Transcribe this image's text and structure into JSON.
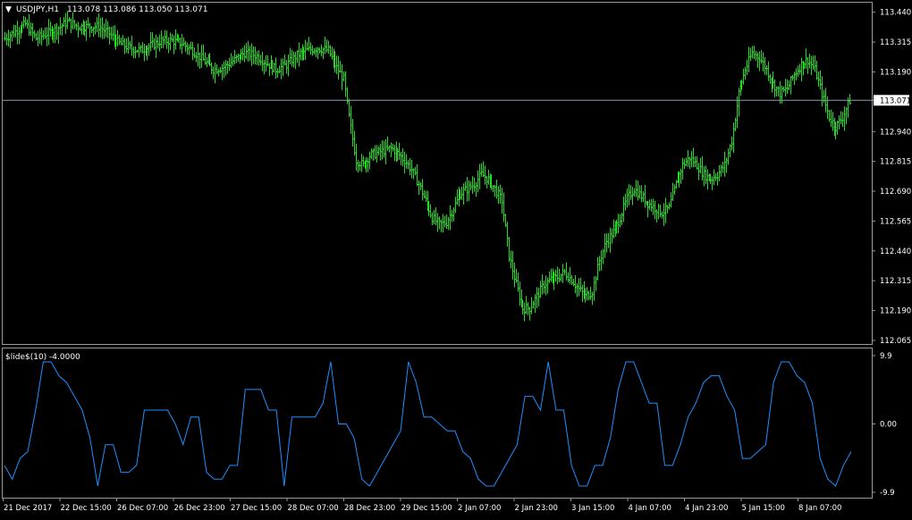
{
  "window": {
    "symbol_label": "USDJPY,H1",
    "ohlc_text": "113.078 113.086 113.050 113.071",
    "dropdown_glyph": "▼"
  },
  "indicator": {
    "label": "$lide$(10) -4.0000"
  },
  "colors": {
    "background": "#000000",
    "candle": "#22dd22",
    "indicator_line": "#1e90ff",
    "frame": "#9a9a9a",
    "grid_text": "#ffffff",
    "price_line": "#8a9fb0",
    "price_tag_bg": "#ffffff",
    "price_tag_text": "#000000"
  },
  "chart_data": [
    {
      "type": "ohlc",
      "symbol": "USDJPY",
      "timeframe": "H1",
      "current_price": 113.071,
      "y_ticks": [
        "113.440",
        "113.315",
        "113.190",
        "113.071",
        "112.940",
        "112.815",
        "112.690",
        "112.565",
        "112.440",
        "112.315",
        "112.190",
        "112.065"
      ],
      "y_tick_values": [
        113.44,
        113.315,
        113.19,
        113.071,
        112.94,
        112.815,
        112.69,
        112.565,
        112.44,
        112.315,
        112.19,
        112.065
      ],
      "ylim": [
        112.05,
        113.48
      ],
      "x_labels": [
        "21 Dec 2017",
        "22 Dec 15:00",
        "26 Dec 07:00",
        "26 Dec 23:00",
        "27 Dec 15:00",
        "28 Dec 07:00",
        "28 Dec 23:00",
        "29 Dec 15:00",
        "2 Jan 07:00",
        "2 Jan 23:00",
        "3 Jan 15:00",
        "4 Jan 07:00",
        "4 Jan 23:00",
        "5 Jan 15:00",
        "8 Jan 07:00"
      ],
      "close_path": [
        [
          0,
          113.33
        ],
        [
          6,
          113.36
        ],
        [
          12,
          113.39
        ],
        [
          18,
          113.33
        ],
        [
          24,
          113.35
        ],
        [
          30,
          113.37
        ],
        [
          36,
          113.4
        ],
        [
          42,
          113.38
        ],
        [
          48,
          113.38
        ],
        [
          54,
          113.38
        ],
        [
          60,
          113.35
        ],
        [
          66,
          113.31
        ],
        [
          72,
          113.29
        ],
        [
          78,
          113.28
        ],
        [
          84,
          113.3
        ],
        [
          90,
          113.32
        ],
        [
          96,
          113.32
        ],
        [
          102,
          113.31
        ],
        [
          108,
          113.28
        ],
        [
          114,
          113.24
        ],
        [
          120,
          113.2
        ],
        [
          126,
          113.21
        ],
        [
          132,
          113.24
        ],
        [
          138,
          113.27
        ],
        [
          144,
          113.26
        ],
        [
          150,
          113.23
        ],
        [
          156,
          113.2
        ],
        [
          162,
          113.22
        ],
        [
          168,
          113.26
        ],
        [
          174,
          113.28
        ],
        [
          180,
          113.29
        ],
        [
          186,
          113.28
        ],
        [
          190,
          113.22
        ],
        [
          195,
          113.16
        ],
        [
          198,
          113.0
        ],
        [
          202,
          112.82
        ],
        [
          206,
          112.8
        ],
        [
          210,
          112.84
        ],
        [
          214,
          112.85
        ],
        [
          218,
          112.86
        ],
        [
          222,
          112.87
        ],
        [
          226,
          112.85
        ],
        [
          230,
          112.82
        ],
        [
          234,
          112.78
        ],
        [
          238,
          112.72
        ],
        [
          242,
          112.65
        ],
        [
          246,
          112.58
        ],
        [
          250,
          112.55
        ],
        [
          254,
          112.56
        ],
        [
          258,
          112.62
        ],
        [
          262,
          112.68
        ],
        [
          266,
          112.7
        ],
        [
          270,
          112.72
        ],
        [
          274,
          112.76
        ],
        [
          278,
          112.74
        ],
        [
          282,
          112.7
        ],
        [
          286,
          112.65
        ],
        [
          290,
          112.42
        ],
        [
          294,
          112.3
        ],
        [
          298,
          112.2
        ],
        [
          302,
          112.2
        ],
        [
          306,
          112.25
        ],
        [
          310,
          112.3
        ],
        [
          314,
          112.32
        ],
        [
          318,
          112.33
        ],
        [
          322,
          112.35
        ],
        [
          326,
          112.32
        ],
        [
          330,
          112.28
        ],
        [
          334,
          112.25
        ],
        [
          338,
          112.27
        ],
        [
          342,
          112.4
        ],
        [
          346,
          112.48
        ],
        [
          350,
          112.52
        ],
        [
          354,
          112.58
        ],
        [
          358,
          112.66
        ],
        [
          362,
          112.7
        ],
        [
          366,
          112.67
        ],
        [
          370,
          112.64
        ],
        [
          374,
          112.62
        ],
        [
          378,
          112.6
        ],
        [
          382,
          112.62
        ],
        [
          386,
          112.72
        ],
        [
          390,
          112.8
        ],
        [
          394,
          112.83
        ],
        [
          398,
          112.8
        ],
        [
          402,
          112.76
        ],
        [
          406,
          112.74
        ],
        [
          410,
          112.76
        ],
        [
          414,
          112.8
        ],
        [
          418,
          112.9
        ],
        [
          422,
          113.1
        ],
        [
          426,
          113.2
        ],
        [
          430,
          113.27
        ],
        [
          434,
          113.25
        ],
        [
          438,
          113.2
        ],
        [
          442,
          113.14
        ],
        [
          446,
          113.1
        ],
        [
          450,
          113.12
        ],
        [
          454,
          113.18
        ],
        [
          458,
          113.22
        ],
        [
          462,
          113.24
        ],
        [
          466,
          113.2
        ],
        [
          470,
          113.1
        ],
        [
          474,
          113.0
        ],
        [
          478,
          112.96
        ],
        [
          482,
          113.0
        ],
        [
          486,
          113.07
        ]
      ]
    },
    {
      "type": "line",
      "name": "$lide$(10)",
      "last_value": -4.0,
      "y_ticks": [
        "9.9",
        "0.00",
        "-9.9"
      ],
      "ylim": [
        -9.9,
        9.9
      ],
      "values": [
        -6,
        -8,
        -5,
        -4,
        2,
        9,
        9,
        7,
        6,
        4,
        2,
        -2,
        -9,
        -3,
        -3,
        -7,
        -7,
        -6,
        2,
        2,
        2,
        2,
        0,
        -3,
        1,
        1,
        -7,
        -8,
        -8,
        -6,
        -6,
        5,
        5,
        5,
        2,
        2,
        -9,
        1,
        1,
        1,
        1,
        3,
        9,
        0,
        0,
        -2,
        -8,
        -9,
        -7,
        -5,
        -3,
        -1,
        9,
        6,
        1,
        1,
        0,
        -1,
        -1,
        -4,
        -5,
        -8,
        -9,
        -9,
        -7,
        -5,
        -3,
        4,
        4,
        2,
        9,
        2,
        2,
        -6,
        -9,
        -9,
        -6,
        -6,
        -2,
        5,
        9,
        9,
        6,
        3,
        3,
        -6,
        -6,
        -3,
        1,
        3,
        6,
        7,
        7,
        4,
        2,
        -5,
        -5,
        -4,
        -3,
        6,
        9,
        9,
        7,
        6,
        3,
        -5,
        -8,
        -9,
        -6,
        -4
      ]
    }
  ]
}
